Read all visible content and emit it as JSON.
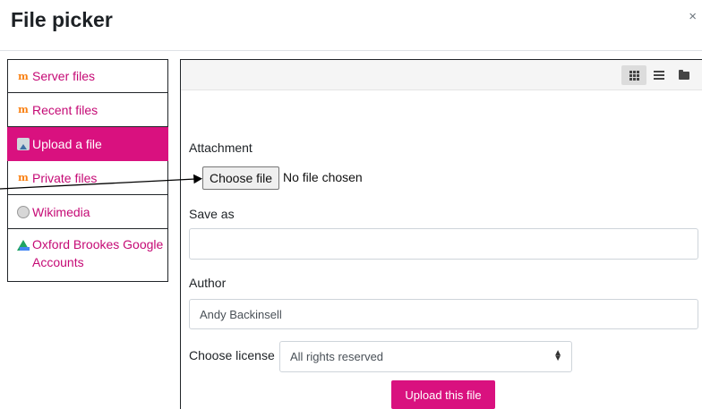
{
  "dialog": {
    "title": "File picker",
    "close_glyph": "×"
  },
  "sidebar": {
    "items": [
      {
        "label": "Server files",
        "icon": "moodle-icon",
        "active": false
      },
      {
        "label": "Recent files",
        "icon": "moodle-icon",
        "active": false
      },
      {
        "label": "Upload a file",
        "icon": "upload-icon",
        "active": true
      },
      {
        "label": "Private files",
        "icon": "moodle-icon",
        "active": false
      },
      {
        "label": "Wikimedia",
        "icon": "wikimedia-icon",
        "active": false
      },
      {
        "label": "Oxford Brookes Google Accounts",
        "icon": "google-drive-icon",
        "active": false
      }
    ]
  },
  "viewbar": {
    "buttons": [
      "grid-view-icon",
      "list-view-icon",
      "folder-view-icon"
    ],
    "active": "grid-view-icon"
  },
  "form": {
    "attachment_label": "Attachment",
    "choose_file_label": "Choose file",
    "file_status": "No file chosen",
    "save_as_label": "Save as",
    "save_as_value": "",
    "author_label": "Author",
    "author_value": "Andy Backinsell",
    "license_label": "Choose license",
    "license_value": "All rights reserved",
    "upload_button": "Upload this file"
  },
  "colors": {
    "accent": "#d9117f",
    "link": "#c50a75",
    "border": "#212529"
  }
}
